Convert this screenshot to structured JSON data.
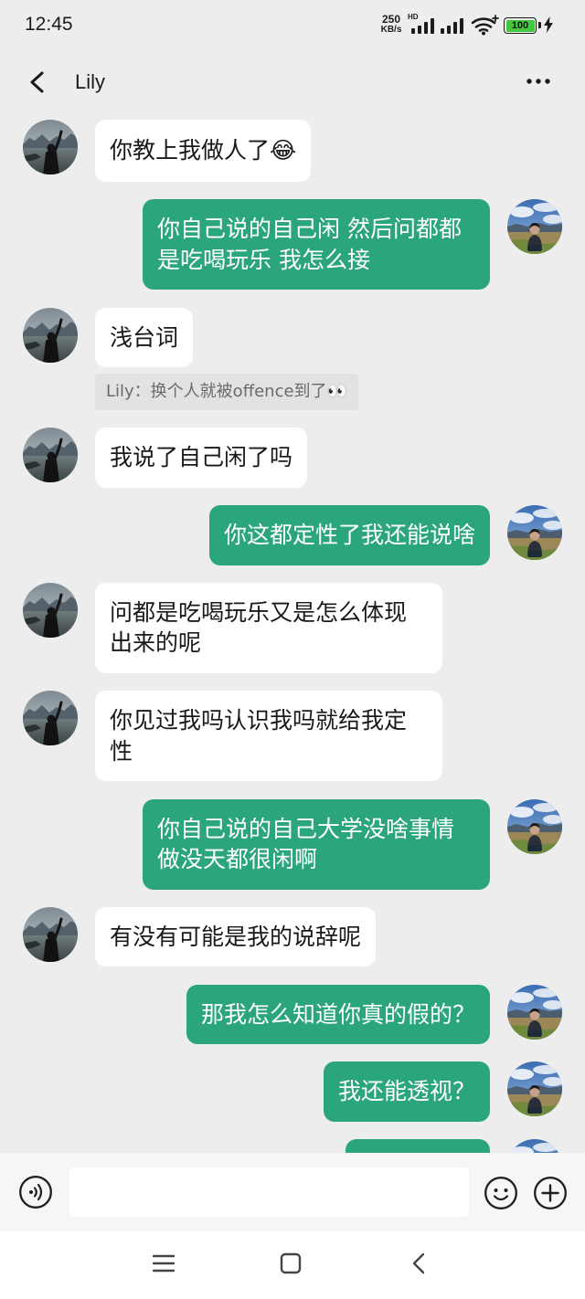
{
  "status_bar": {
    "time": "12:45",
    "net_speed": {
      "value": "250",
      "unit": "KB/s"
    },
    "network_label": "HD",
    "battery_level": "100",
    "icons": {
      "signal_primary": "signal-icon",
      "signal_secondary": "signal-icon",
      "wifi": "wifi-icon",
      "battery": "battery-icon",
      "charging": "charging-bolt-icon"
    }
  },
  "header": {
    "title": "Lily",
    "back_icon": "chevron-left-icon",
    "more_icon": "more-icon"
  },
  "messages": [
    {
      "text": "你教上我做人了😂"
    },
    {
      "text": "你自己说的自己闲 然后问都都是吃喝玩乐 我怎么接"
    },
    {
      "text": "浅台词",
      "quote": "Lily：换个人就被offence到了👀"
    },
    {
      "text": "我说了自己闲了吗"
    },
    {
      "text": "你这都定性了我还能说啥"
    },
    {
      "text": "问都是吃喝玩乐又是怎么体现出来的呢"
    },
    {
      "text": "你见过我吗认识我吗就给我定性"
    },
    {
      "text": "你自己说的自己大学没啥事情做没天都很闲啊"
    },
    {
      "text": "有没有可能是我的说辞呢"
    },
    {
      "text": "那我怎么知道你真的假的？"
    },
    {
      "text": "我还能透视？"
    }
  ],
  "composer": {
    "input_value": "",
    "voice_icon": "voice-icon",
    "emoji_icon": "emoji-icon",
    "plus_icon": "plus-circle-icon"
  },
  "nav_bar": {
    "menu_icon": "menu-icon",
    "home_icon": "home-square-icon",
    "back_icon": "back-icon"
  },
  "colors": {
    "chat_background": "#ededed",
    "incoming_bubble": "#ffffff",
    "outgoing_bubble": "#2aa57e",
    "outgoing_text": "#ffffff",
    "battery_fill": "#43c640"
  }
}
